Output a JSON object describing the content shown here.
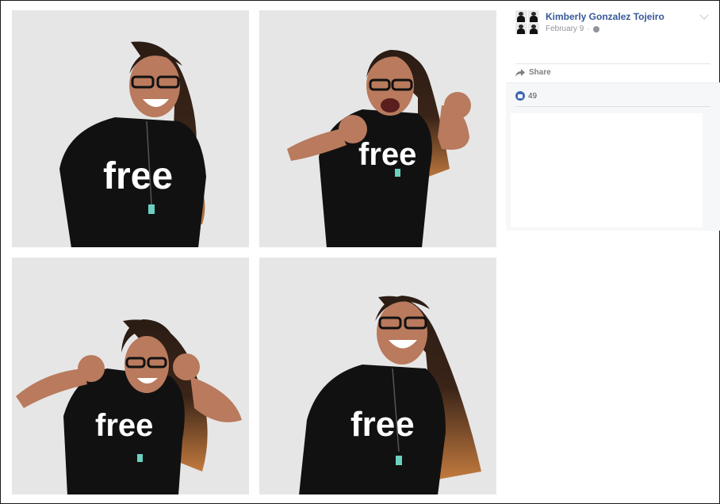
{
  "post": {
    "author": "Kimberly Gonzalez Tojeiro",
    "date": "February 9",
    "privacy_icon": "globe-icon",
    "options_icon": "chevron-down-icon"
  },
  "actions": {
    "share_label": "Share",
    "share_icon": "share-arrow-icon"
  },
  "reactions": {
    "like_icon": "thumbs-up-icon",
    "count": "49"
  },
  "photos": [
    {
      "id": "p1",
      "shirt_text": "free",
      "pose": "smiling"
    },
    {
      "id": "p2",
      "shirt_text": "free",
      "pose": "fists-raised"
    },
    {
      "id": "p3",
      "shirt_text": "free",
      "pose": "arms-up-laughing"
    },
    {
      "id": "p4",
      "shirt_text": "free",
      "pose": "head-tilted-laughing"
    }
  ],
  "colors": {
    "link": "#365899",
    "meta": "#90949c",
    "backdrop": "#e6e6e6",
    "shirt": "#111111",
    "hair_dark": "#2b1c14",
    "hair_light": "#c27a3e",
    "skin": "#b97a5d"
  }
}
